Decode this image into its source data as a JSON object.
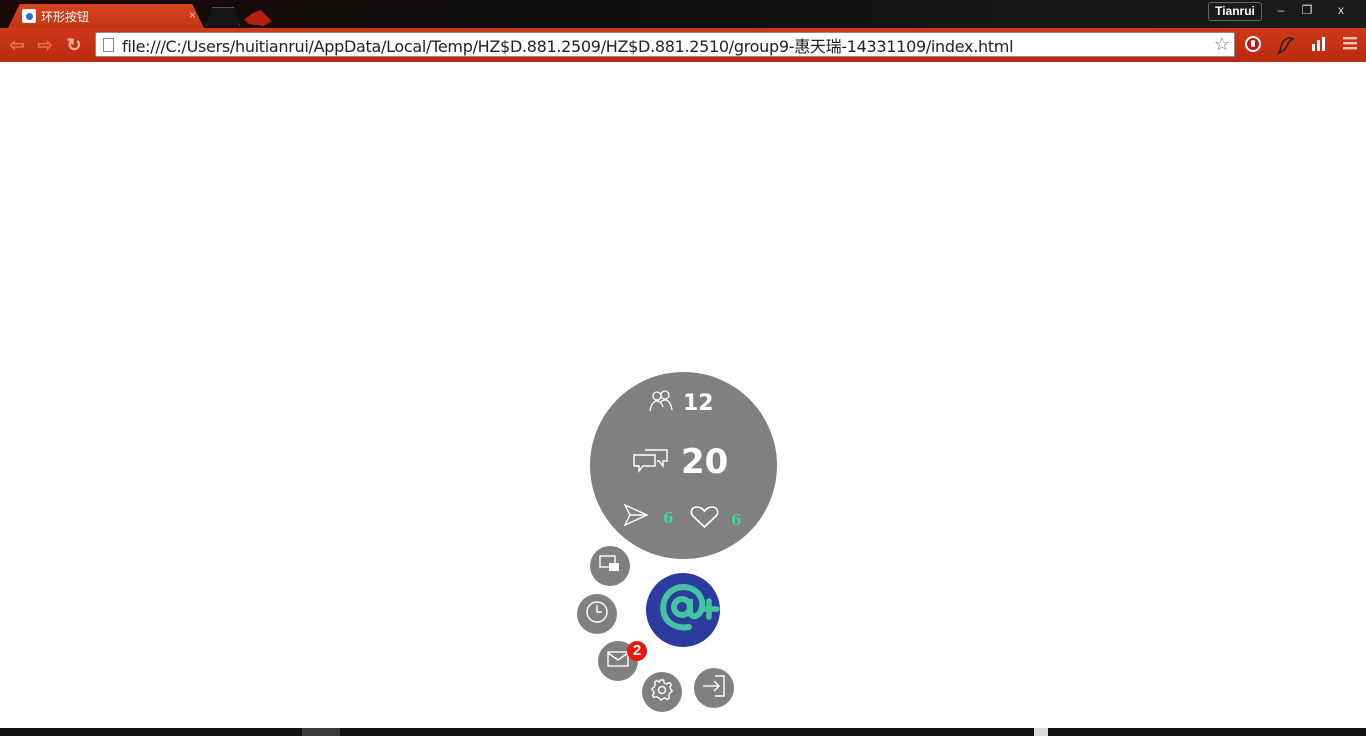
{
  "browser": {
    "tab_title": "环形按钮",
    "tab_close": "×",
    "profile_name": "Tianrui",
    "window_controls": {
      "minimize": "–",
      "restore": "❐",
      "close": "x"
    },
    "nav": {
      "back": "⇦",
      "forward": "⇨",
      "reload": "↻"
    },
    "url": "file:///C:/Users/huitianrui/AppData/Local/Temp/HZ$D.881.2509/HZ$D.881.2510/group9-惠天瑞-14331109/index.html",
    "bookmark_icon": "star-icon",
    "extensions": [
      "adblock-icon",
      "dragon-icon",
      "bars-icon"
    ],
    "menu_icon": "hamburger-icon"
  },
  "stats": {
    "followers": {
      "icon": "people-icon",
      "value": "12"
    },
    "comments": {
      "icon": "chat-bubbles-icon",
      "value": "20"
    },
    "shares": {
      "icon": "send-icon",
      "value": "6"
    },
    "likes": {
      "icon": "heart-icon",
      "value": "6"
    }
  },
  "main_button": {
    "icon": "at-plus-icon",
    "color": "#2d3a9e",
    "accent": "#43c4a0"
  },
  "menu_buttons": [
    {
      "name": "windows",
      "icon": "windows-icon"
    },
    {
      "name": "history",
      "icon": "clock-icon"
    },
    {
      "name": "messages",
      "icon": "mail-icon",
      "badge": "2"
    },
    {
      "name": "settings",
      "icon": "gear-icon"
    },
    {
      "name": "logout",
      "icon": "exit-icon"
    }
  ],
  "colors": {
    "circle_gray": "#808080",
    "stat_green": "#43d692",
    "badge_red": "#e8190d",
    "chrome_red": "#c23616"
  }
}
